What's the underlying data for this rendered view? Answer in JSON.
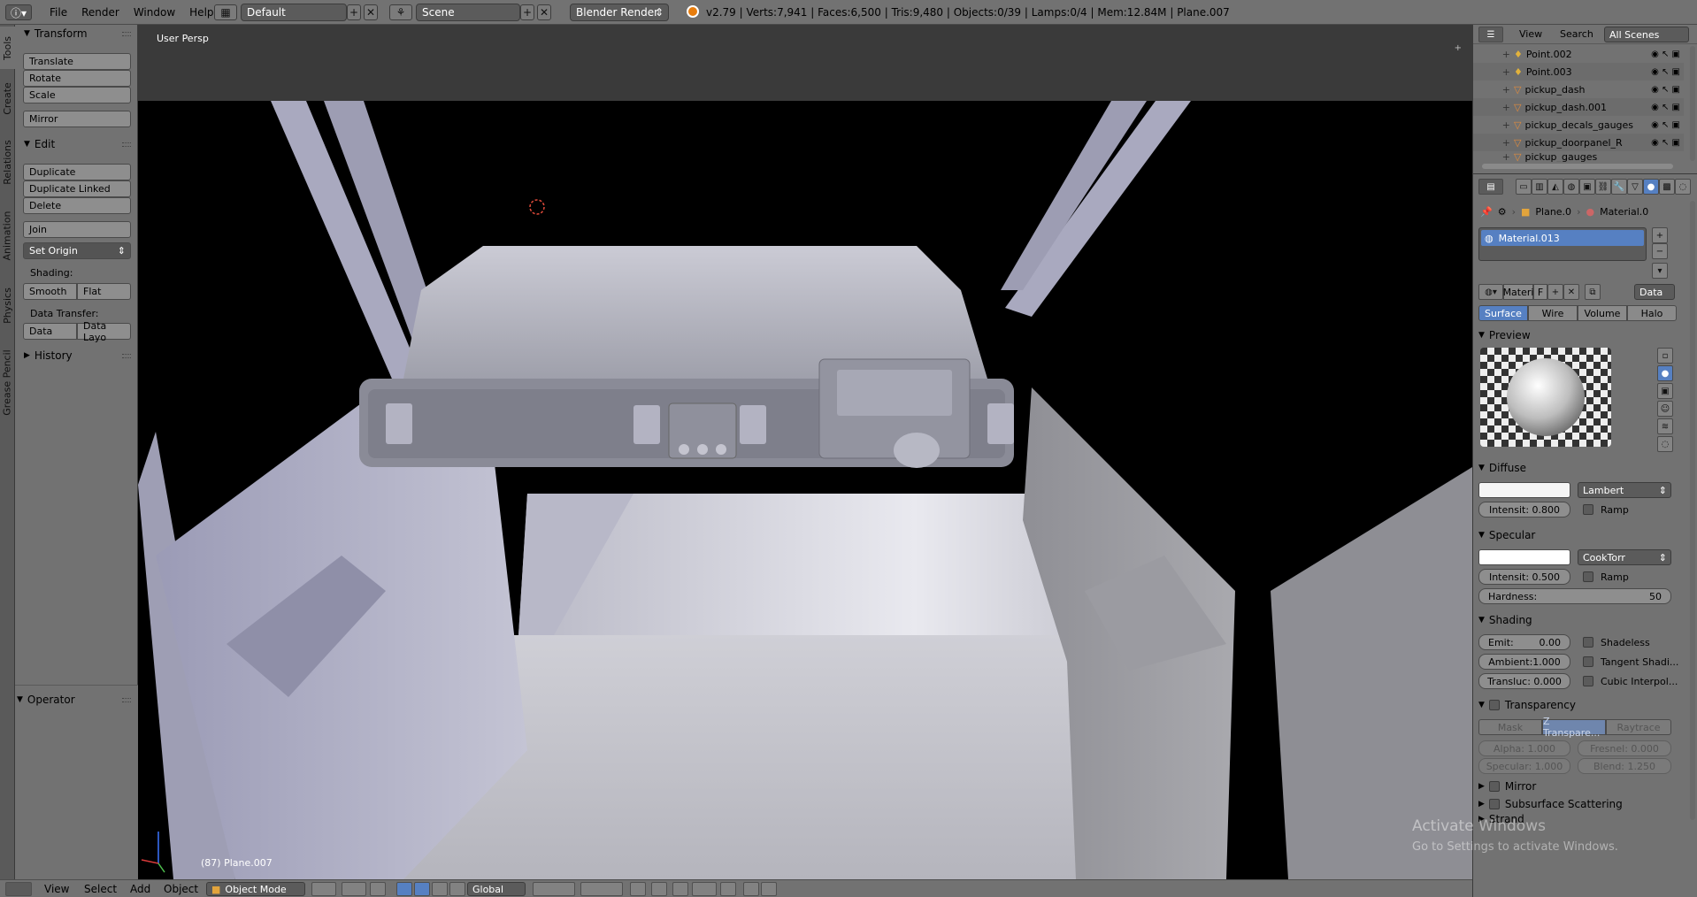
{
  "menu": {
    "file": "File",
    "render": "Render",
    "window": "Window",
    "help": "Help",
    "layout": "Default",
    "scene": "Scene",
    "engine": "Blender Render",
    "stats": "v2.79 | Verts:7,941 | Faces:6,500 | Tris:9,480 | Objects:0/39 | Lamps:0/4 | Mem:12.84M | Plane.007"
  },
  "tabs": [
    "Tools",
    "Create",
    "Relations",
    "Animation",
    "Physics",
    "Grease Pencil"
  ],
  "toolshelf": {
    "transform_header": "Transform",
    "translate": "Translate",
    "rotate": "Rotate",
    "scale": "Scale",
    "mirror": "Mirror",
    "edit_header": "Edit",
    "duplicate": "Duplicate",
    "duplicate_linked": "Duplicate Linked",
    "delete": "Delete",
    "join": "Join",
    "set_origin": "Set Origin",
    "shading_label": "Shading:",
    "smooth": "Smooth",
    "flat": "Flat",
    "data_transfer_label": "Data Transfer:",
    "data": "Data",
    "data_layout": "Data Layo",
    "history_header": "History",
    "operator_header": "Operator"
  },
  "viewport": {
    "view_name": "User Persp",
    "object_label": "(87) Plane.007"
  },
  "bottombar": {
    "view": "View",
    "select": "Select",
    "add": "Add",
    "object": "Object",
    "mode": "Object Mode",
    "orientation": "Global"
  },
  "outliner": {
    "view": "View",
    "search": "Search",
    "scenes": "All Scenes",
    "items": [
      "Point.002",
      "Point.003",
      "pickup_dash",
      "pickup_dash.001",
      "pickup_decals_gauges",
      "pickup_doorpanel_R",
      "pickup_gauges"
    ]
  },
  "properties": {
    "breadcrumb_object": "Plane.0",
    "breadcrumb_material": "Material.0",
    "material_slot": "Material.013",
    "material_name": "Materi",
    "fake_user": "F",
    "data_dropdown": "Data",
    "tabs": [
      "Surface",
      "Wire",
      "Volume",
      "Halo"
    ],
    "preview_header": "Preview",
    "diffuse_header": "Diffuse",
    "diffuse_shader": "Lambert",
    "diffuse_intensity": "Intensit: 0.800",
    "ramp": "Ramp",
    "specular_header": "Specular",
    "specular_shader": "CookTorr",
    "specular_intensity": "Intensit: 0.500",
    "hardness": "Hardness:",
    "hardness_value": "50",
    "shading_header": "Shading",
    "emit": "Emit:",
    "emit_value": "0.00",
    "ambient": "Ambient:1.000",
    "transluc": "Transluc: 0.000",
    "shadeless": "Shadeless",
    "tangent": "Tangent Shadi...",
    "cubic": "Cubic Interpol...",
    "transparency_header": "Transparency",
    "trans_modes": [
      "Mask",
      "Z Transpare...",
      "Raytrace"
    ],
    "alpha": "Alpha: 1.000",
    "fresnel": "Fresnel: 0.000",
    "specular_alpha": "Specular: 1.000",
    "blend": "Blend: 1.250",
    "mirror_header": "Mirror",
    "sss_header": "Subsurface Scattering",
    "strand_header": "Strand"
  },
  "watermark": {
    "line1": "Activate Windows",
    "line2": "Go to Settings to activate Windows."
  },
  "colors": {
    "accent": "#5680c2",
    "panel": "#727272",
    "viewport_bg": "#000000"
  }
}
